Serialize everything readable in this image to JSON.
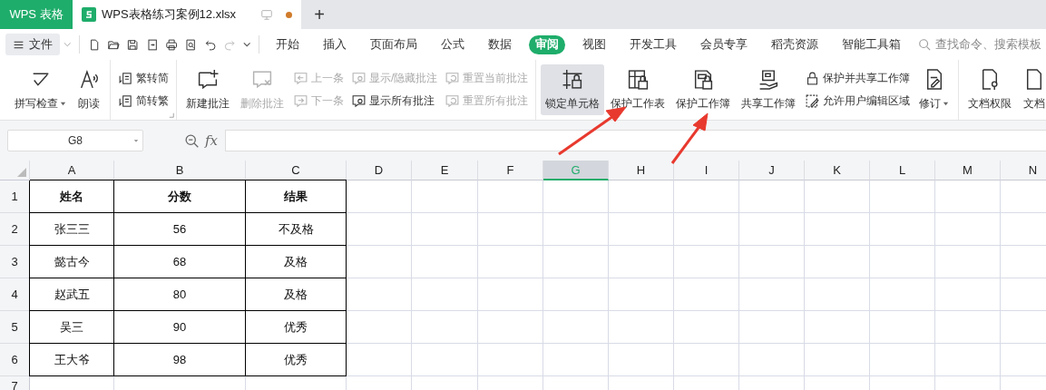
{
  "titlebar": {
    "app_tab": "WPS 表格",
    "doc_tab": {
      "title": "WPS表格练习案例12.xlsx",
      "unsaved": true
    },
    "new_tab": "+"
  },
  "menubar": {
    "file_menu": "文件",
    "tabs": [
      {
        "label": "开始",
        "selected": false
      },
      {
        "label": "插入",
        "selected": false
      },
      {
        "label": "页面布局",
        "selected": false
      },
      {
        "label": "公式",
        "selected": false
      },
      {
        "label": "数据",
        "selected": false
      },
      {
        "label": "审阅",
        "selected": true
      },
      {
        "label": "视图",
        "selected": false
      },
      {
        "label": "开发工具",
        "selected": false
      },
      {
        "label": "会员专享",
        "selected": false
      },
      {
        "label": "稻壳资源",
        "selected": false
      },
      {
        "label": "智能工具箱",
        "selected": false
      }
    ],
    "search": {
      "placeholder": "查找命令、搜索模板"
    }
  },
  "ribbon": {
    "groups": [
      {
        "launcher": false,
        "columns": [
          {
            "kind": "large",
            "label": "拼写检查",
            "caret": true,
            "disabled": false,
            "active": false
          },
          {
            "kind": "large",
            "label": "朗读",
            "caret": false,
            "disabled": false,
            "active": false
          }
        ]
      },
      {
        "launcher": true,
        "columns": [
          {
            "kind": "stack",
            "items": [
              {
                "label": "繁转简",
                "disabled": false
              },
              {
                "label": "简转繁",
                "disabled": false
              }
            ]
          }
        ]
      },
      {
        "launcher": false,
        "columns": [
          {
            "kind": "large",
            "label": "新建批注",
            "caret": false,
            "disabled": false,
            "active": false
          },
          {
            "kind": "large",
            "label": "删除批注",
            "caret": false,
            "disabled": true,
            "active": false
          },
          {
            "kind": "stack",
            "items": [
              {
                "label": "上一条",
                "disabled": true
              },
              {
                "label": "下一条",
                "disabled": true
              }
            ]
          },
          {
            "kind": "stack",
            "items": [
              {
                "label": "显示/隐藏批注",
                "disabled": true
              },
              {
                "label": "显示所有批注",
                "disabled": false
              }
            ]
          },
          {
            "kind": "stack",
            "items": [
              {
                "label": "重置当前批注",
                "disabled": true
              },
              {
                "label": "重置所有批注",
                "disabled": true
              }
            ]
          }
        ]
      },
      {
        "launcher": false,
        "columns": [
          {
            "kind": "large",
            "label": "锁定单元格",
            "caret": false,
            "disabled": false,
            "active": true
          },
          {
            "kind": "large",
            "label": "保护工作表",
            "caret": false,
            "disabled": false,
            "active": false
          },
          {
            "kind": "large",
            "label": "保护工作簿",
            "caret": false,
            "disabled": false,
            "active": false
          },
          {
            "kind": "large",
            "label": "共享工作簿",
            "caret": false,
            "disabled": false,
            "active": false
          },
          {
            "kind": "stack",
            "items": [
              {
                "label": "保护并共享工作簿",
                "disabled": false
              },
              {
                "label": "允许用户编辑区域",
                "disabled": false
              }
            ]
          },
          {
            "kind": "large",
            "label": "修订",
            "caret": true,
            "disabled": false,
            "active": false
          }
        ]
      },
      {
        "launcher": false,
        "columns": [
          {
            "kind": "large",
            "label": "文档权限",
            "caret": false,
            "disabled": false,
            "active": false
          },
          {
            "kind": "large",
            "label": "文档",
            "caret": false,
            "disabled": false,
            "active": false
          }
        ]
      }
    ]
  },
  "formula_bar": {
    "name_box": "G8",
    "fx": "fx"
  },
  "sheet": {
    "columns": [
      {
        "label": "A",
        "selected": false
      },
      {
        "label": "B",
        "selected": false
      },
      {
        "label": "C",
        "selected": false
      },
      {
        "label": "D",
        "selected": false
      },
      {
        "label": "E",
        "selected": false
      },
      {
        "label": "F",
        "selected": false
      },
      {
        "label": "G",
        "selected": true
      },
      {
        "label": "H",
        "selected": false
      },
      {
        "label": "I",
        "selected": false
      },
      {
        "label": "J",
        "selected": false
      },
      {
        "label": "K",
        "selected": false
      },
      {
        "label": "L",
        "selected": false
      },
      {
        "label": "M",
        "selected": false
      },
      {
        "label": "N",
        "selected": false
      }
    ],
    "rows": [
      {
        "label": "1",
        "cells": [
          "姓名",
          "分数",
          "结果"
        ],
        "header": true
      },
      {
        "label": "2",
        "cells": [
          "张三三",
          "56",
          "不及格"
        ],
        "header": false
      },
      {
        "label": "3",
        "cells": [
          "懿古今",
          "68",
          "及格"
        ],
        "header": false
      },
      {
        "label": "4",
        "cells": [
          "赵武五",
          "80",
          "及格"
        ],
        "header": false
      },
      {
        "label": "5",
        "cells": [
          "吴三",
          "90",
          "优秀"
        ],
        "header": false
      },
      {
        "label": "6",
        "cells": [
          "王大爷",
          "98",
          "优秀"
        ],
        "header": false
      },
      {
        "label": "7",
        "cells": []
      }
    ]
  }
}
